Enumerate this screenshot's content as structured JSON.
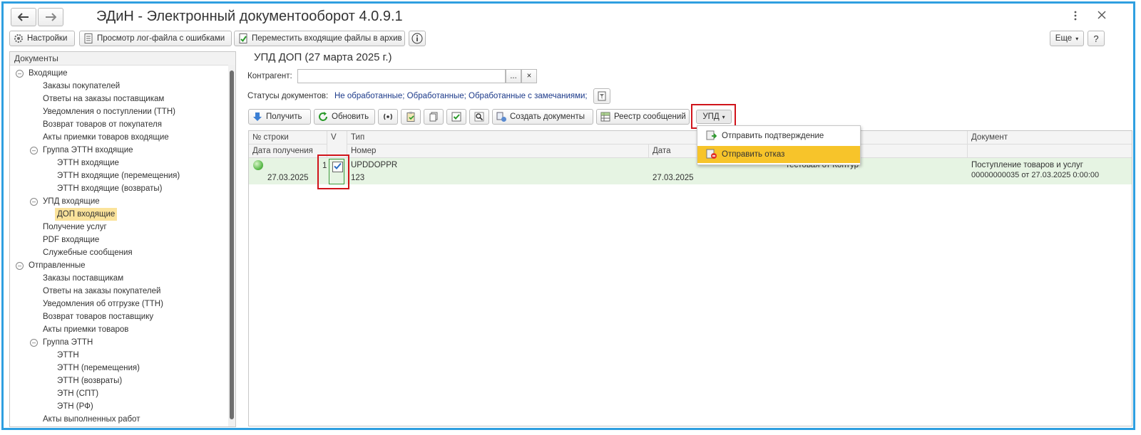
{
  "window": {
    "title": "ЭДиН - Электронный документооборот 4.0.9.1",
    "back_icon": "arrow-left-icon",
    "forward_icon": "arrow-right-icon",
    "kebab_icon": "vertical-dots-icon",
    "close_icon": "close-icon"
  },
  "toolbar": {
    "settings": "Настройки",
    "view_log": "Просмотр лог-файла с ошибками",
    "archive": "Переместить входящие файлы в архив",
    "more": "Еще",
    "help": "?"
  },
  "tree": {
    "header": "Документы",
    "items": [
      "Входящие",
      "Заказы покупателей",
      "Ответы на заказы поставщикам",
      "Уведомления о поступлении (ТТН)",
      "Возврат товаров от покупателя",
      "Акты приемки товаров входящие",
      "Группа ЭТТН входящие",
      "ЭТТН входящие",
      "ЭТТН входящие (перемещения)",
      "ЭТТН входящие (возвраты)",
      "УПД входящие",
      "ДОП входящие",
      "Получение услуг",
      "PDF входящие",
      "Служебные сообщения",
      "Отправленные",
      "Заказы поставщикам",
      "Ответы на заказы покупателей",
      "Уведомления об отгрузке (ТТН)",
      "Возврат товаров поставщику",
      "Акты приемки товаров",
      "Группа ЭТТН",
      "ЭТТН",
      "ЭТТН (перемещения)",
      "ЭТТН (возвраты)",
      "ЭТН (СПТ)",
      "ЭТН (РФ)",
      "Акты выполненных работ"
    ]
  },
  "main": {
    "heading": "УПД ДОП (27 марта 2025 г.)",
    "contractor_label": "Контрагент:",
    "contractor_value": "",
    "select_btn": "...",
    "clear_btn": "×",
    "statuses_label": "Статусы документов:",
    "statuses_value": "Не обработанные; Обработанные; Обработанные с замечаниями;",
    "buttons": {
      "receive": "Получить",
      "refresh": "Обновить",
      "create_docs": "Создать документы",
      "registry": "Реестр сообщений",
      "upd": "УПД"
    },
    "menu": {
      "confirm": "Отправить подтверждение",
      "reject": "Отправить отказ"
    },
    "grid": {
      "headers_top": [
        "№ строки",
        "V",
        "Тип",
        "Документ"
      ],
      "headers_bottom": [
        "Дата получения",
        "Номер",
        "Дата"
      ],
      "row": {
        "line_no": "1",
        "received_date": "27.03.2025",
        "type": "UPDDOPPR",
        "number": "123",
        "date": "27.03.2025",
        "contractor": "тестовая от Контур",
        "document_line1": "Поступление товаров и услуг",
        "document_line2": "00000000035 от 27.03.2025 0:00:00"
      }
    }
  },
  "colors": {
    "accent_border": "#2f9fe0",
    "row_highlight": "#e6f4e3",
    "selected_tree": "#fbe39b",
    "menu_highlight": "#f7c42a",
    "annotation_red": "#d0141b"
  }
}
